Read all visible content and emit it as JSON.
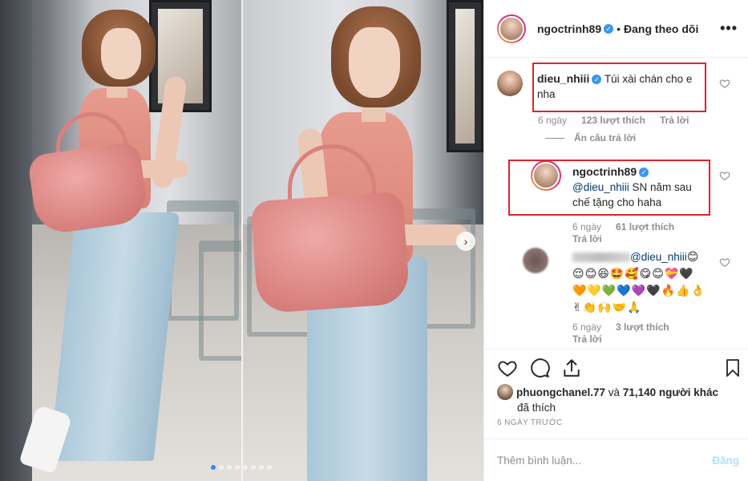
{
  "post": {
    "carousel": {
      "dot_count": 8,
      "active_index": 0
    },
    "header": {
      "username": "ngoctrinh89",
      "separator": "•",
      "follow_status": "Đang theo dõi",
      "more_icon": "more-horizontal-icon"
    },
    "comments": [
      {
        "username": "dieu_nhiii",
        "verified": true,
        "text": "Túi xài chán cho e nha",
        "time": "6 ngày",
        "likes": "123 lượt thích",
        "reply": "Trả lời",
        "hide_replies": "Ẩn câu trả lời"
      },
      {
        "username": "ngoctrinh89",
        "verified": true,
        "mention": "@dieu_nhiii",
        "text": "SN năm sau chế tặng cho haha",
        "time": "6 ngày",
        "likes": "61 lượt thích",
        "reply": "Trả lời"
      },
      {
        "mention": "@dieu_nhiii",
        "emoji_line1": "😊",
        "emoji_line2": "😌😊😆🤩🥰😋😊💝🖤",
        "emoji_line3": "🧡💛💚💙💜🖤🔥👍👌",
        "emoji_line4": "✌👏🙌🤝🙏",
        "time": "6 ngày",
        "likes": "3 lượt thích",
        "reply": "Trả lời"
      }
    ],
    "likes_line": {
      "user": "phuongchanel.77",
      "connector": "và",
      "count": "71,140 người khác",
      "suffix": "đã thích"
    },
    "posted_ago": "6 NGÀY TRƯỚC",
    "add_comment": {
      "placeholder": "Thêm bình luận...",
      "post_label": "Đăng"
    },
    "highlight_color": "#e0222e",
    "accent_color": "#3897f0"
  }
}
